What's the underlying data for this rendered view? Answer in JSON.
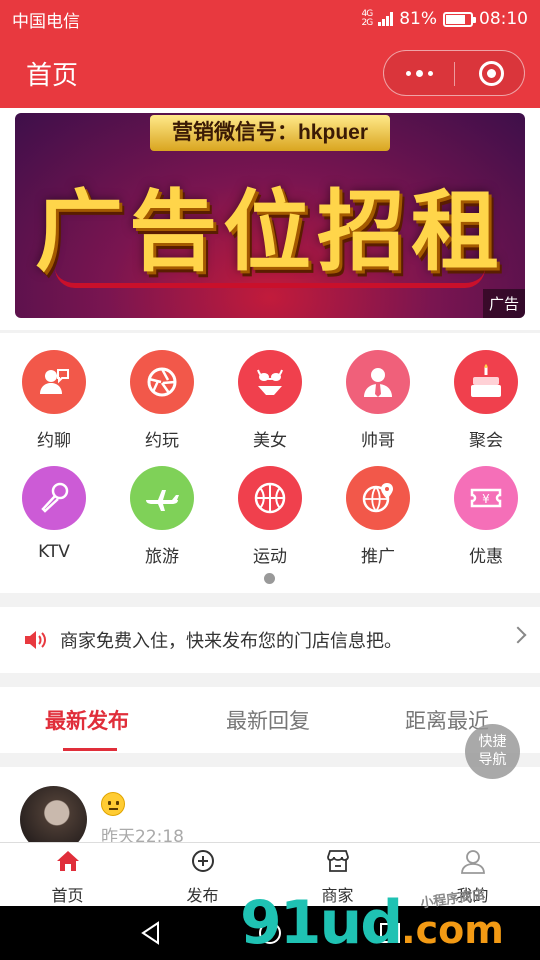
{
  "status_bar": {
    "carrier": "中国电信",
    "network": "4G 2G",
    "battery": "81%",
    "battery_level": 0.81,
    "time": "08:10"
  },
  "navbar": {
    "title": "首页"
  },
  "banner": {
    "ribbon_text": "营销微信号：hkpuer",
    "main_text": "广告位招租",
    "ad_tag": "广告"
  },
  "grid": {
    "items": [
      {
        "label": "约聊",
        "icon": "chat-person-icon",
        "color": "#f2584a"
      },
      {
        "label": "约玩",
        "icon": "aperture-icon",
        "color": "#f2584a"
      },
      {
        "label": "美女",
        "icon": "bikini-icon",
        "color": "#f0404d"
      },
      {
        "label": "帅哥",
        "icon": "man-tie-icon",
        "color": "#f0607a"
      },
      {
        "label": "聚会",
        "icon": "cake-icon",
        "color": "#f0404d"
      },
      {
        "label": "KTV",
        "icon": "microphone-icon",
        "color": "#cc5bd6"
      },
      {
        "label": "旅游",
        "icon": "airplane-icon",
        "color": "#7fd158"
      },
      {
        "label": "运动",
        "icon": "basketball-icon",
        "color": "#f0404d"
      },
      {
        "label": "推广",
        "icon": "globe-pin-icon",
        "color": "#f2584a"
      },
      {
        "label": "优惠",
        "icon": "ticket-icon",
        "color": "#f56fb8"
      }
    ]
  },
  "notice": {
    "text": "商家免费入住，快来发布您的门店信息把。"
  },
  "tabs": [
    {
      "label": "最新发布",
      "active": true
    },
    {
      "label": "最新回复",
      "active": false
    },
    {
      "label": "距离最近",
      "active": false
    }
  ],
  "post": {
    "time": "昨天22:18"
  },
  "fab": {
    "line1": "快捷",
    "line2": "导航"
  },
  "tabbar": [
    {
      "label": "首页",
      "icon": "home-icon",
      "active": true
    },
    {
      "label": "发布",
      "icon": "plus-circle-icon",
      "active": false
    },
    {
      "label": "商家",
      "icon": "store-icon",
      "active": false
    },
    {
      "label": "我的",
      "icon": "user-icon",
      "active": false
    }
  ],
  "watermark": {
    "main": "91ud",
    "suffix": ".com",
    "small": "小程序商店"
  },
  "colors": {
    "accent": "#e8393f",
    "active_tab": "#e02e3a"
  }
}
